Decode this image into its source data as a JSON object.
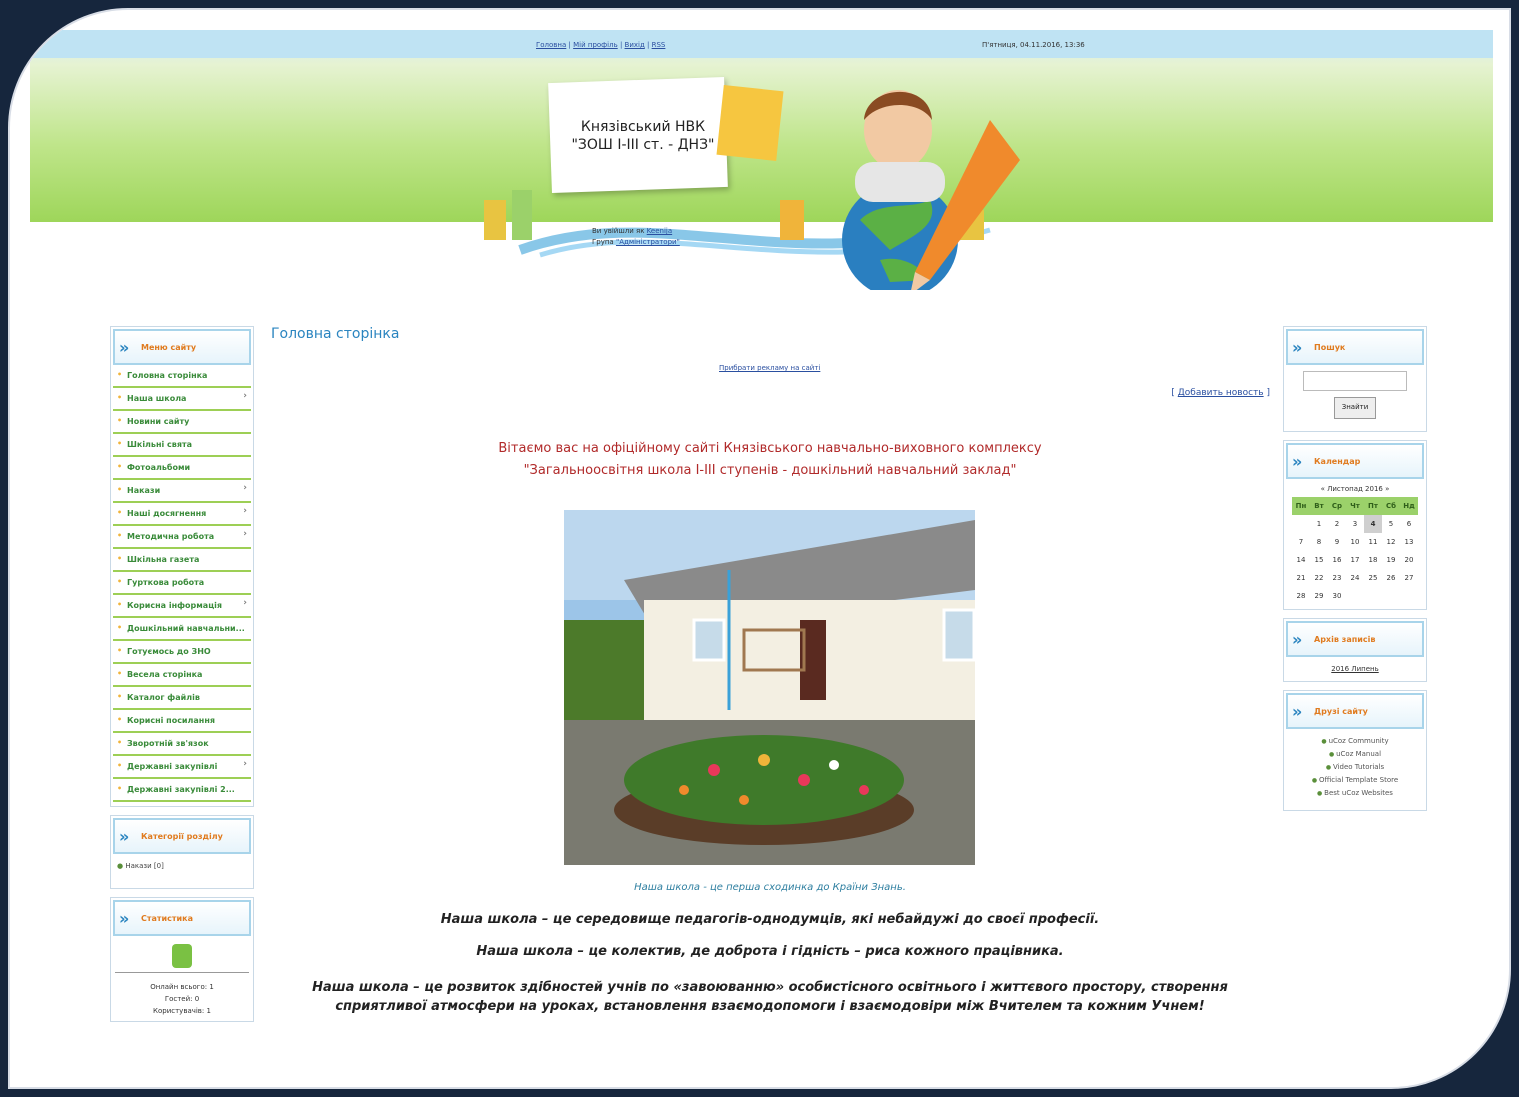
{
  "header": {
    "top_links": [
      "Головна",
      "Мій профіль",
      "Вихід",
      "RSS"
    ],
    "datetime": "П'ятниця, 04.11.2016, 13:36",
    "site_title_line1": "Князівський НВК",
    "site_title_line2": "\"ЗОШ І-ІІІ ст. - ДНЗ\"",
    "logged_prefix": "Ви увійшли як",
    "logged_user": "Keenija",
    "group_prefix": "Група",
    "group_name": "\"Адміністратори\""
  },
  "sidebar_menu": {
    "title": "Меню сайту",
    "items": [
      {
        "label": "Головна сторінка",
        "sub": false
      },
      {
        "label": "Наша школа",
        "sub": true
      },
      {
        "label": "Новини сайту",
        "sub": false
      },
      {
        "label": "Шкільні свята",
        "sub": false
      },
      {
        "label": "Фотоальбоми",
        "sub": false
      },
      {
        "label": "Накази",
        "sub": true
      },
      {
        "label": "Наші досягнення",
        "sub": true
      },
      {
        "label": "Методична робота",
        "sub": true
      },
      {
        "label": "Шкільна газета",
        "sub": false
      },
      {
        "label": "Гурткова робота",
        "sub": false
      },
      {
        "label": "Корисна інформація",
        "sub": true
      },
      {
        "label": "Дошкільний навчальни...",
        "sub": false
      },
      {
        "label": "Готуємось до ЗНО",
        "sub": false
      },
      {
        "label": "Весела сторінка",
        "sub": false
      },
      {
        "label": "Каталог файлів",
        "sub": false
      },
      {
        "label": "Корисні посилання",
        "sub": false
      },
      {
        "label": "Зворотній зв'язок",
        "sub": false
      },
      {
        "label": "Державні закупівлі",
        "sub": true
      },
      {
        "label": "Державні закупівлі 2...",
        "sub": false
      }
    ]
  },
  "categories": {
    "title": "Категорії розділу",
    "item": "Накази [0]"
  },
  "stats": {
    "title": "Статистика",
    "online": "Онлайн всього: 1",
    "guests": "Гостей: 0",
    "users": "Користувачів: 1"
  },
  "main": {
    "page_title": "Головна сторінка",
    "ad_link": "Прибрати рекламу на сайті",
    "add_news": "Добавить новость",
    "welcome_line1": "Вітаємо вас на офіційному сайті Князівського навчально-виховного комплексу",
    "welcome_line2": "\"Загальноосвітня школа І-ІІІ ступенів - дошкільний навчальний заклад\"",
    "caption": "Наша школа - це перша сходинка до Країни Знань.",
    "p1": "Наша школа – це середовище педагогів-однодумців, які небайдужі до своєї професії.",
    "p2": "Наша школа – це колектив, де доброта і гідність – риса кожного працівника.",
    "p3_line1": "Наша школа – це розвиток здібностей учнів по «завоюванню» особистісного освітнього і життєвого простору, створення",
    "p3_line2": "сприятливої атмосфери на уроках, встановлення взаємодопомоги і взаємодовіри між Вчителем та кожним Учнем!"
  },
  "search": {
    "title": "Пошук",
    "button": "Знайти"
  },
  "calendar": {
    "title": "Календар",
    "month": "« Листопад 2016 »",
    "days": [
      "Пн",
      "Вт",
      "Ср",
      "Чт",
      "Пт",
      "Сб",
      "Нд"
    ],
    "weeks": [
      [
        "",
        "1",
        "2",
        "3",
        "4",
        "5",
        "6"
      ],
      [
        "7",
        "8",
        "9",
        "10",
        "11",
        "12",
        "13"
      ],
      [
        "14",
        "15",
        "16",
        "17",
        "18",
        "19",
        "20"
      ],
      [
        "21",
        "22",
        "23",
        "24",
        "25",
        "26",
        "27"
      ],
      [
        "28",
        "29",
        "30",
        "",
        "",
        "",
        ""
      ]
    ],
    "today": "4"
  },
  "archive": {
    "title": "Архів записів",
    "item": "2016 Липень"
  },
  "friends": {
    "title": "Друзі сайту",
    "items": [
      "uCoz Community",
      "uCoz Manual",
      "Video Tutorials",
      "Official Template Store",
      "Best uCoz Websites"
    ]
  }
}
